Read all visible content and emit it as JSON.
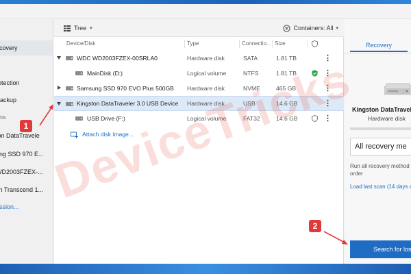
{
  "toolbar": {
    "view_label": "Tree",
    "containers_label": "Containers: All"
  },
  "sidebar": {
    "items": [
      {
        "label": "ecovery",
        "state": "active"
      },
      {
        "label": "rotection",
        "state": "normal"
      },
      {
        "label": "Backup",
        "state": "normal"
      },
      {
        "label": "ons",
        "state": "muted"
      },
      {
        "label": "ton DataTravele",
        "state": "normal"
      },
      {
        "label": "ung SSD 970 E...",
        "state": "normal"
      },
      {
        "label": "WD2003FZEX-...",
        "state": "normal"
      },
      {
        "label": "sh Transcend 1...",
        "state": "normal"
      },
      {
        "label": "ession...",
        "state": "link"
      }
    ]
  },
  "columns": {
    "device": "Device/Disk",
    "type": "Type",
    "connection": "Connectio...",
    "size": "Size"
  },
  "rows": [
    {
      "name": "WDC WD2003FZEX-00SRLA0",
      "type": "Hardware disk",
      "connection": "SATA",
      "size": "1.81 TB",
      "status": ""
    },
    {
      "name": "MainDisk (D:)",
      "type": "Logical volume",
      "connection": "NTFS",
      "size": "1.81 TB",
      "status": "protected"
    },
    {
      "name": "Samsung SSD 970 EVO Plus 500GB",
      "type": "Hardware disk",
      "connection": "NVME",
      "size": "465 GB",
      "status": ""
    },
    {
      "name": "Kingston DataTraveler 3.0 USB Device",
      "type": "Hardware disk",
      "connection": "USB",
      "size": "14.6 GB",
      "status": ""
    },
    {
      "name": "USB Drive (F:)",
      "type": "Logical volume",
      "connection": "FAT32",
      "size": "14.6 GB",
      "status": "unprotected"
    }
  ],
  "attach_label": "Attach disk image...",
  "panel": {
    "tab": "Recovery",
    "device_name": "Kingston DataTravel",
    "device_type": "Hardware disk",
    "method": "All recovery me",
    "description_line1": "Run all recovery method",
    "description_line2": "order",
    "last_scan_link": "Load last scan (14 days a",
    "search_button": "Search for los"
  },
  "annotations": {
    "badge_1": "1",
    "badge_2": "2",
    "watermark": "DeviceTricks"
  },
  "colors": {
    "accent": "#1e6cc4",
    "annotation": "#e23a3a",
    "shield_ok": "#2aa44a"
  }
}
